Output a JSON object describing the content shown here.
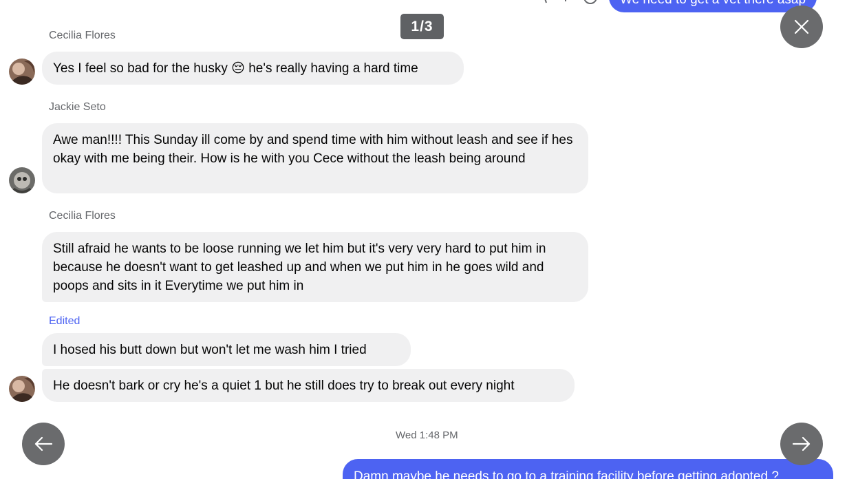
{
  "viewer": {
    "counter": "1/3",
    "close_icon": "close-icon",
    "prev_icon": "arrow-left-icon",
    "next_icon": "arrow-right-icon"
  },
  "top_partial": {
    "outgoing_text": "We need to get a vet there asap"
  },
  "messages": {
    "group1": {
      "sender": "Cecilia Flores",
      "text": "Yes I feel so bad for the husky 😔 he's really having a hard time"
    },
    "group2": {
      "sender": "Jackie Seto",
      "text": "Awe man!!!! This Sunday ill come by and spend time with him without leash and see if hes okay with me being their. How is he with you Cece without the leash being around"
    },
    "group3": {
      "sender": "Cecilia Flores",
      "text": "Still afraid he wants to be loose running we let him but it's very very hard to put him in because he doesn't want to get leashed up and when we put him in he goes wild and poops and sits in it Everytime we put him in"
    },
    "group4": {
      "edited_label": "Edited",
      "text1": "I hosed his butt down but won't let me wash him I tried",
      "text2": "He doesn't bark or cry he's a quiet 1 but he still does try to break out every night"
    }
  },
  "timestamp": "Wed 1:48 PM",
  "bottom_partial": {
    "outgoing_text": "Damn maybe he needs to go to a training facility before getting adopted ?"
  },
  "colors": {
    "incoming_bubble": "#f0f0f1",
    "outgoing_bubble": "#4d63f2",
    "overlay_button": "#6a6b6d"
  }
}
